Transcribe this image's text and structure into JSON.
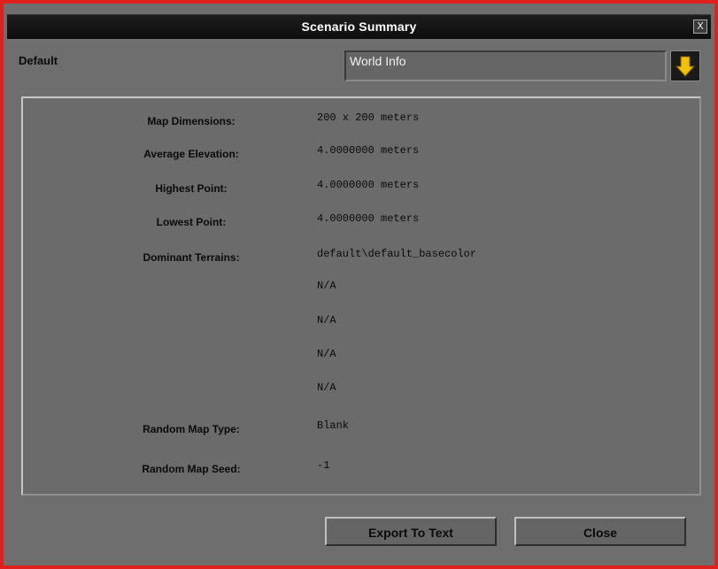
{
  "window": {
    "title": "Scenario Summary",
    "close_label": "X"
  },
  "header": {
    "profile_label": "Default",
    "dropdown": {
      "selected": "World Info"
    }
  },
  "summary": {
    "rows": [
      {
        "label": "Map Dimensions:",
        "value": "200 x 200 meters"
      },
      {
        "label": "Average Elevation:",
        "value": "4.0000000 meters"
      },
      {
        "label": "Highest Point:",
        "value": "4.0000000 meters"
      },
      {
        "label": "Lowest Point:",
        "value": "4.0000000 meters"
      },
      {
        "label": "Dominant Terrains:",
        "value": "default\\default_basecolor"
      },
      {
        "label": "",
        "value": "N/A"
      },
      {
        "label": "",
        "value": "N/A"
      },
      {
        "label": "",
        "value": "N/A"
      },
      {
        "label": "",
        "value": "N/A"
      },
      {
        "label": "Random Map Type:",
        "value": "Blank"
      },
      {
        "label": "Random Map Seed:",
        "value": "-1"
      }
    ]
  },
  "footer": {
    "export_label": "Export To Text",
    "close_label": "Close"
  },
  "colors": {
    "frame_border": "#e0201c",
    "dialog_bg": "#6e6e6e",
    "titlebar_bg": "#111111",
    "arrow_yellow": "#f2c200"
  },
  "icons": {
    "dropdown_arrow": "arrow-down-icon",
    "close": "close-icon"
  }
}
